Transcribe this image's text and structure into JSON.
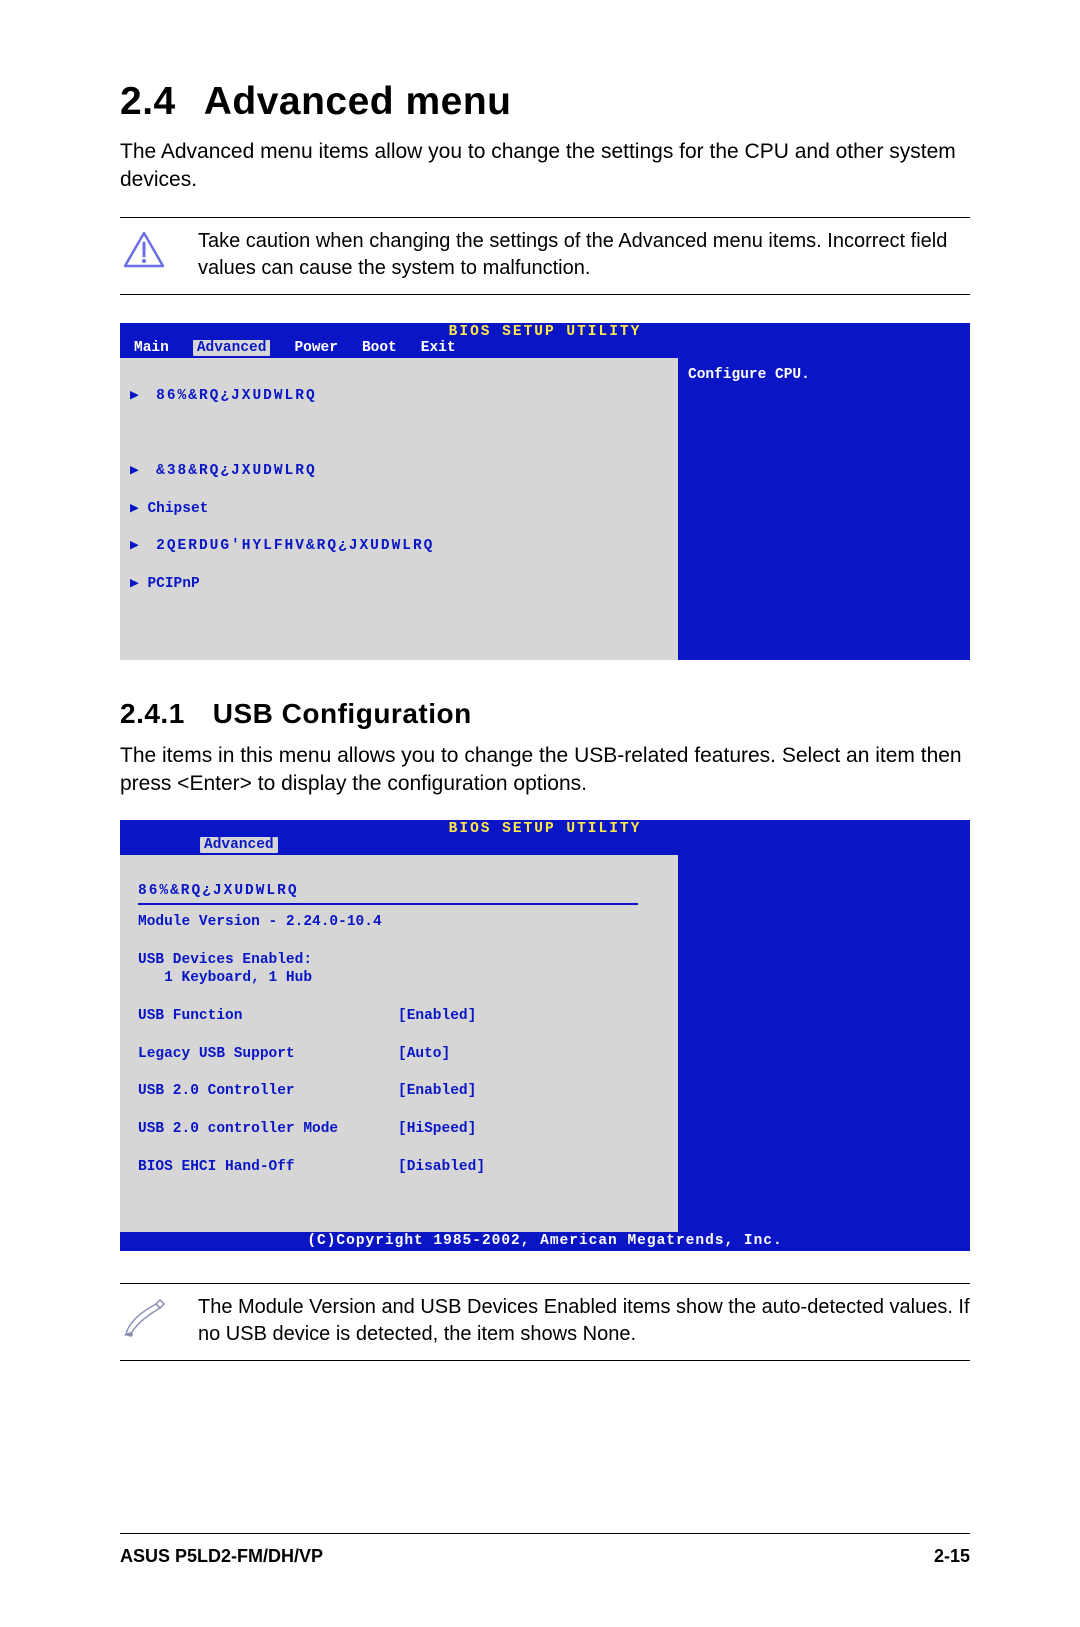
{
  "section": {
    "number": "2.4",
    "title": "Advanced menu",
    "intro": "The Advanced menu items allow you to change the settings for the CPU and other system devices."
  },
  "caution": {
    "text": "Take caution when changing the settings of the Advanced menu items. Incorrect field values can cause the system to malfunction."
  },
  "bios1": {
    "title": "BIOS SETUP UTILITY",
    "tabs": [
      "Main",
      "Advanced",
      "Power",
      "Boot",
      "Exit"
    ],
    "active_tab": "Advanced",
    "menu_items": [
      "86%&RQ¿JXUDWLRQ",
      "&38&RQ¿JXUDWLRQ",
      "Chipset",
      "2QERDUG'HYLFHV&RQ¿JXUDWLRQ",
      "PCIPnP"
    ],
    "help": "Configure CPU."
  },
  "subsection": {
    "number": "2.4.1",
    "title": "USB Configuration",
    "intro": "The items in this menu allows you to change the USB-related features. Select an item then press <Enter> to display the configuration options."
  },
  "bios2": {
    "title": "BIOS SETUP UTILITY",
    "active_tab": "Advanced",
    "section_label": "86%&RQ¿JXUDWLRQ",
    "info_lines": [
      "Module Version - 2.24.0-10.4",
      "",
      "USB Devices Enabled:",
      "   1 Keyboard, 1 Hub"
    ],
    "settings": [
      {
        "label": "USB Function",
        "value": "[Enabled]"
      },
      {
        "label": "Legacy USB Support",
        "value": "[Auto]"
      },
      {
        "label": "USB 2.0 Controller",
        "value": "[Enabled]"
      },
      {
        "label": "USB 2.0 controller Mode",
        "value": "[HiSpeed]"
      },
      {
        "label": "BIOS EHCI Hand-Off",
        "value": "[Disabled]"
      }
    ],
    "copyright": "(C)Copyright 1985-2002, American Megatrends, Inc."
  },
  "note": {
    "text": "The Module Version and USB Devices Enabled items show the auto-detected values. If no USB device is detected, the item shows None."
  },
  "footer": {
    "left": "ASUS P5LD2-FM/DH/VP",
    "right": "2-15"
  }
}
